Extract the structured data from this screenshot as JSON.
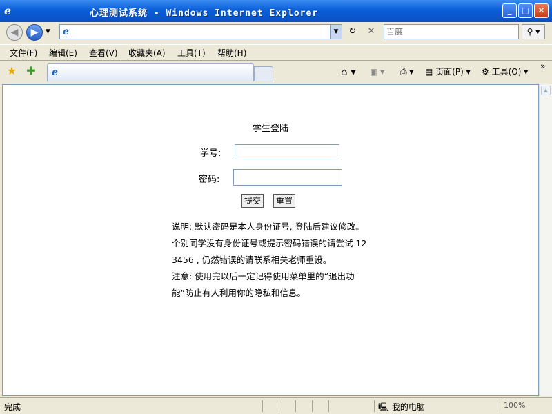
{
  "window": {
    "title": "心理测试系统 - Windows Internet Explorer"
  },
  "toolbar": {
    "search_placeholder": "百度"
  },
  "menu": {
    "items": [
      "文件(F)",
      "编辑(E)",
      "查看(V)",
      "收藏夹(A)",
      "工具(T)",
      "帮助(H)"
    ]
  },
  "commandbar": {
    "page_label": "页面(P)",
    "tools_label": "工具(O)"
  },
  "form": {
    "title": "学生登陆",
    "id_label": "学号:",
    "password_label": "密码:",
    "submit_label": "提交",
    "reset_label": "重置"
  },
  "notes": {
    "line1": "说明: 默认密码是本人身份证号, 登陆后建议修改。个别同学没有身份证号或提示密码错误的请尝试 123456 , 仍然错误的请联系相关老师重设。",
    "line2": "注意: 使用完以后一定记得使用菜单里的“退出功能”防止有人利用你的隐私和信息。"
  },
  "status": {
    "text": "完成",
    "zone": "我的电脑",
    "zoom": "100%"
  }
}
